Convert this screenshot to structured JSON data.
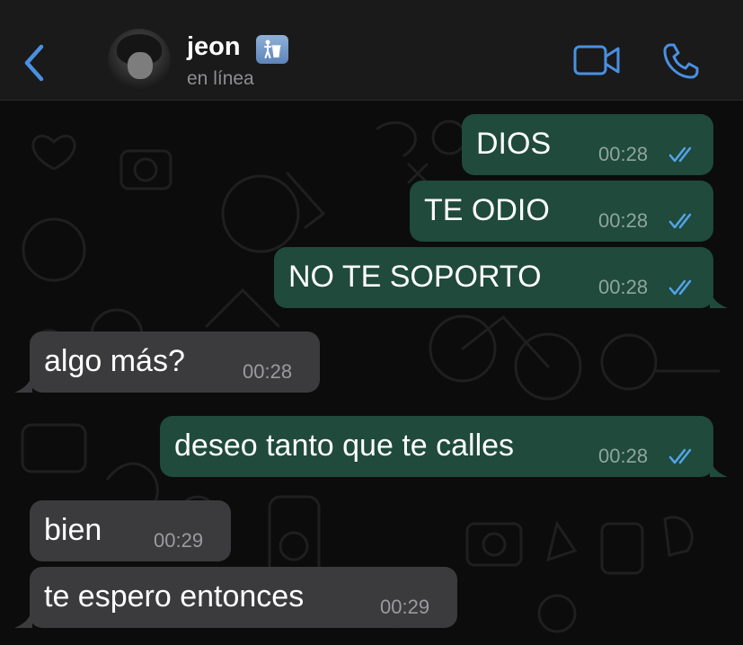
{
  "header": {
    "contact_name": "jeon",
    "status": "en línea",
    "name_badge_icon": "trash-icon"
  },
  "colors": {
    "accent": "#4a90e2",
    "outgoing_bubble": "#1f4a3c",
    "incoming_bubble": "#3b3b3d",
    "read_ticks": "#53a4e8",
    "header_bg": "#1a1a1a"
  },
  "messages": [
    {
      "direction": "out",
      "text": "DIOS",
      "time": "00:28",
      "status": "read"
    },
    {
      "direction": "out",
      "text": "TE ODIO",
      "time": "00:28",
      "status": "read"
    },
    {
      "direction": "out",
      "text": "NO TE SOPORTO",
      "time": "00:28",
      "status": "read"
    },
    {
      "direction": "in",
      "text": "algo más?",
      "time": "00:28"
    },
    {
      "direction": "out",
      "text": "deseo tanto que te calles",
      "time": "00:28",
      "status": "read"
    },
    {
      "direction": "in",
      "text": "bien",
      "time": "00:29"
    },
    {
      "direction": "in",
      "text": "te espero entonces",
      "time": "00:29"
    }
  ]
}
